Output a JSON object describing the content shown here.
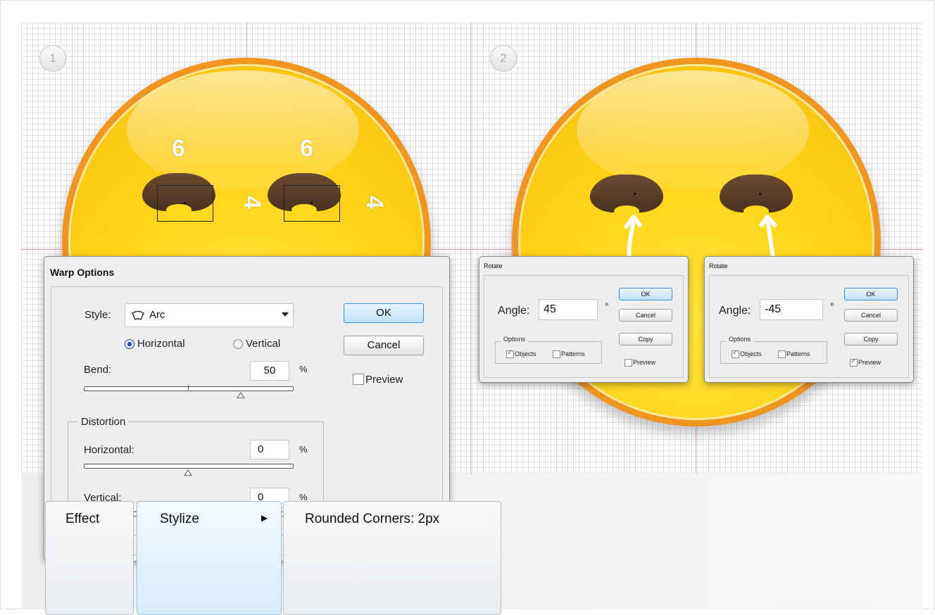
{
  "steps": [
    "1",
    "2"
  ],
  "dimensions": {
    "eye_width_left": "6",
    "eye_width_right": "6",
    "eye_height_left": "4",
    "eye_height_right": "4"
  },
  "warp_dialog": {
    "title": "Warp Options",
    "style_label": "Style:",
    "style_value": "Arc",
    "orientation_horizontal": "Horizontal",
    "orientation_vertical": "Vertical",
    "orientation_selected": "Horizontal",
    "bend_label": "Bend:",
    "bend_value": "50",
    "percent": "%",
    "distortion_label": "Distortion",
    "distortion_horizontal_label": "Horizontal:",
    "distortion_horizontal_value": "0",
    "distortion_vertical_label": "Vertical:",
    "distortion_vertical_value": "0",
    "ok": "OK",
    "cancel": "Cancel",
    "preview": "Preview",
    "preview_checked": false
  },
  "rotate_dialogs": [
    {
      "title": "Rotate",
      "angle_label": "Angle:",
      "angle_value": "45",
      "degree": "°",
      "ok": "OK",
      "cancel": "Cancel",
      "copy": "Copy",
      "options_label": "Options",
      "objects": "Objects",
      "objects_checked": true,
      "patterns": "Patterns",
      "patterns_checked": false,
      "preview": "Preview",
      "preview_checked": false
    },
    {
      "title": "Rotate",
      "angle_label": "Angle:",
      "angle_value": "-45",
      "degree": "°",
      "ok": "OK",
      "cancel": "Cancel",
      "copy": "Copy",
      "options_label": "Options",
      "objects": "Objects",
      "objects_checked": true,
      "patterns": "Patterns",
      "patterns_checked": false,
      "preview": "Preview",
      "preview_checked": true
    }
  ],
  "menu_path": {
    "effect": "Effect",
    "stylize": "Stylize",
    "arrow": "▶",
    "rounded_corners": "Rounded Corners: 2px"
  },
  "colors": {
    "face_rim": "#f0951f",
    "face_fill": "#ffd51a",
    "eye": "#5a3c28",
    "guide": "#f4a3a3",
    "primary_button": "#bfe0fb"
  }
}
